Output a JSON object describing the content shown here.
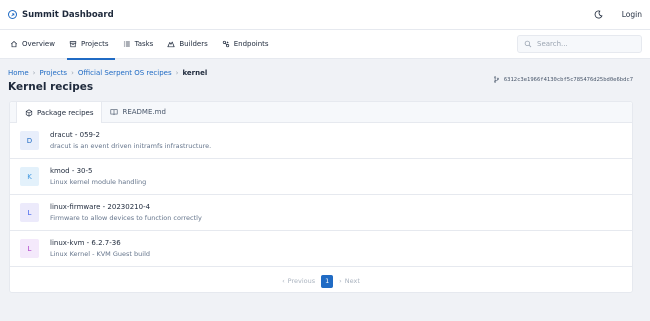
{
  "header": {
    "brand_prefix": "Summit",
    "brand_suffix": "Dashboard",
    "login_label": "Login"
  },
  "nav": {
    "items": [
      {
        "label": "Overview",
        "icon": "home-icon"
      },
      {
        "label": "Projects",
        "icon": "box-icon"
      },
      {
        "label": "Tasks",
        "icon": "list-icon"
      },
      {
        "label": "Builders",
        "icon": "builder-icon"
      },
      {
        "label": "Endpoints",
        "icon": "endpoint-icon"
      }
    ],
    "active": "Projects",
    "search_placeholder": "Search..."
  },
  "breadcrumb": {
    "items": [
      "Home",
      "Projects",
      "Official Serpent OS recipes"
    ],
    "current": "kernel"
  },
  "page": {
    "title": "Kernel recipes",
    "commit": "6312c3e1966f4130cbf5c785476d25bd0e6bdc7"
  },
  "tabs": [
    {
      "label": "Package recipes",
      "icon": "package-icon"
    },
    {
      "label": "README.md",
      "icon": "book-icon"
    }
  ],
  "packages": [
    {
      "initial": "D",
      "title": "dracut - 059-2",
      "description": "dracut is an event driven initramfs infrastructure.",
      "bg": "#e8eefb",
      "fg": "#206bc4"
    },
    {
      "initial": "K",
      "title": "kmod - 30-5",
      "description": "Linux kernel module handling",
      "bg": "#e3f1fb",
      "fg": "#4299e1"
    },
    {
      "initial": "L",
      "title": "linux-firmware - 20230210-4",
      "description": "Firmware to allow devices to function correctly",
      "bg": "#eceafb",
      "fg": "#4263eb"
    },
    {
      "initial": "L",
      "title": "linux-kvm - 6.2.7-36",
      "description": "Linux Kernel - KVM Guest build",
      "bg": "#f4e9fb",
      "fg": "#ae3ec9"
    }
  ],
  "pagination": {
    "previous_label": "Previous",
    "next_label": "Next",
    "current_page": "1"
  },
  "colors": {
    "accent": "#206bc4",
    "background": "#f0f2f6"
  }
}
